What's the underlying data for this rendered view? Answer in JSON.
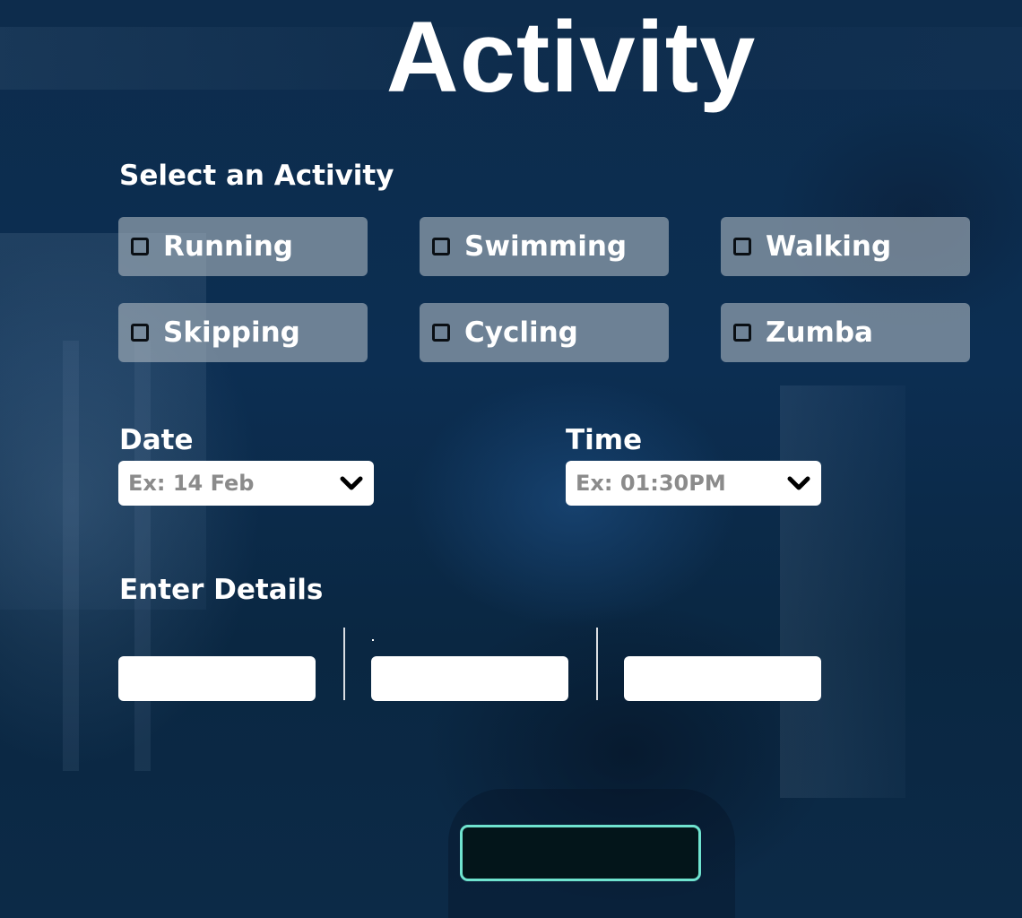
{
  "page": {
    "title": "Activity"
  },
  "activity_section": {
    "label": "Select an Activity",
    "options": [
      {
        "label": "Running",
        "checked": false
      },
      {
        "label": "Swimming",
        "checked": false
      },
      {
        "label": "Walking",
        "checked": false
      },
      {
        "label": "Skipping",
        "checked": false
      },
      {
        "label": "Cycling",
        "checked": false
      },
      {
        "label": "Zumba",
        "checked": false
      }
    ]
  },
  "date": {
    "label": "Date",
    "placeholder": "Ex: 14 Feb"
  },
  "time": {
    "label": "Time",
    "placeholder": "Ex: 01:30PM"
  },
  "details": {
    "label": "Enter Details",
    "fields": [
      {
        "value": "",
        "placeholder": ""
      },
      {
        "value": "",
        "placeholder": ""
      },
      {
        "value": "",
        "placeholder": ""
      }
    ]
  },
  "submit": {
    "label": ""
  },
  "colors": {
    "background": "#0b2744",
    "option_fill": "#a9b3bd",
    "button_border": "#6fe3cf",
    "button_fill": "#03151a",
    "placeholder_text": "#8b8b8b"
  },
  "icons": {
    "dropdown": "chevron-down-icon",
    "checkbox": "checkbox-icon"
  }
}
